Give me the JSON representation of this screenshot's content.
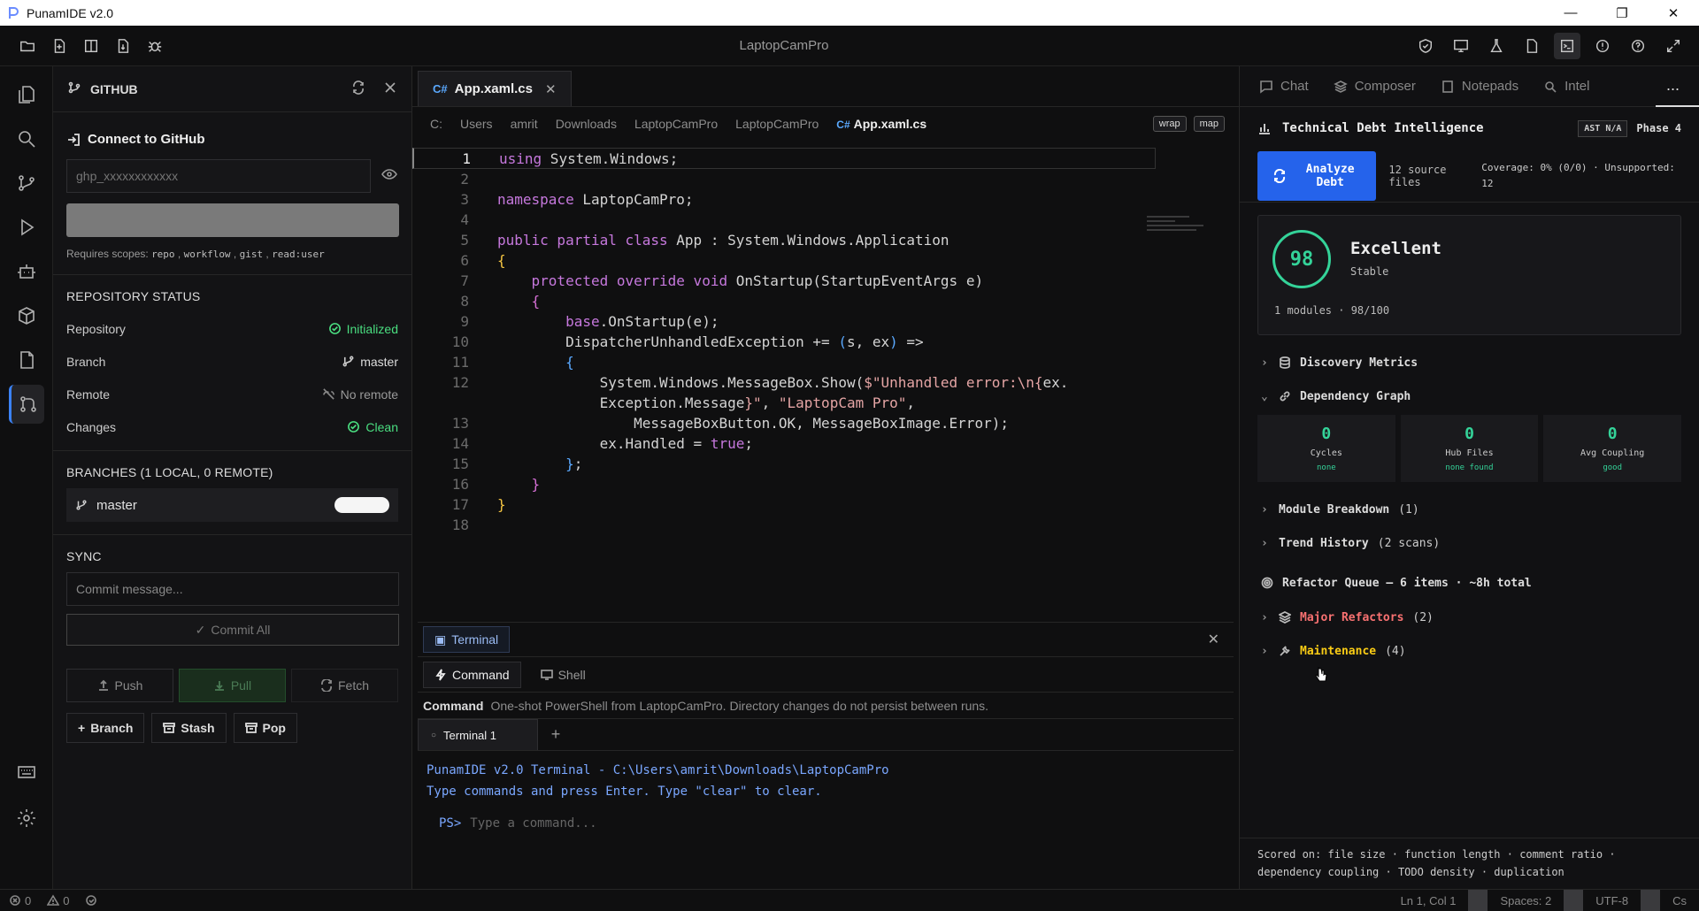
{
  "window": {
    "title": "PunamIDE v2.0",
    "project": "LaptopCamPro"
  },
  "sidebar": {
    "header": "GITHUB",
    "connect_title": "Connect to GitHub",
    "token_placeholder": "ghp_xxxxxxxxxxxx",
    "scopes_label": "Requires scopes:",
    "scopes": [
      "repo",
      "workflow",
      "gist",
      "read:user"
    ],
    "repo_status_title": "REPOSITORY STATUS",
    "repo_status": [
      {
        "label": "Repository",
        "value": "Initialized"
      },
      {
        "label": "Branch",
        "value": "master"
      },
      {
        "label": "Remote",
        "value": "No remote"
      },
      {
        "label": "Changes",
        "value": "Clean"
      }
    ],
    "branches_title": "BRANCHES (1 LOCAL, 0 REMOTE)",
    "branch_name": "master",
    "sync_title": "SYNC",
    "commit_placeholder": "Commit message...",
    "commit_all": "Commit All",
    "push": "Push",
    "pull": "Pull",
    "fetch": "Fetch",
    "branch_btn": "Branch",
    "stash_btn": "Stash",
    "pop_btn": "Pop"
  },
  "editor": {
    "tab": "App.xaml.cs",
    "tab_lang": "C#",
    "breadcrumbs": [
      "C:",
      "Users",
      "amrit",
      "Downloads",
      "LaptopCamPro",
      "LaptopCamPro"
    ],
    "breadcrumb_file": "App.xaml.cs",
    "wrap": "wrap",
    "map": "map",
    "line_numbers": [
      "1",
      "2",
      "3",
      "4",
      "5",
      "6",
      "7",
      "8",
      "9",
      "10",
      "11",
      "12",
      "",
      "13",
      "14",
      "15",
      "16",
      "17",
      "18"
    ]
  },
  "terminal": {
    "panel_tab": "Terminal",
    "mode_command": "Command",
    "mode_shell": "Shell",
    "desc_label": "Command",
    "desc": "One-shot PowerShell from LaptopCamPro. Directory changes do not persist between runs.",
    "tab": "Terminal 1",
    "out1": "PunamIDE v2.0 Terminal - C:\\Users\\amrit\\Downloads\\LaptopCamPro",
    "out2": "Type commands and press Enter. Type \"clear\" to clear.",
    "prompt": "PS>",
    "input_placeholder": "Type a command..."
  },
  "right": {
    "tabs": [
      "Chat",
      "Composer",
      "Notepads",
      "Intel"
    ],
    "more": "...",
    "title": "Technical Debt Intelligence",
    "badge": "AST N/A",
    "phase": "Phase 4",
    "analyze": "Analyze Debt",
    "source_files": "12 source files",
    "coverage": "Coverage: 0% (0/0) · Unsupported: 12",
    "score": "98",
    "grade": "Excellent",
    "trend": "Stable",
    "modules": "1 modules · 98/100",
    "discovery": "Discovery Metrics",
    "dependency": "Dependency Graph",
    "metrics": [
      {
        "value": "0",
        "label": "Cycles",
        "sub": "none"
      },
      {
        "value": "0",
        "label": "Hub Files",
        "sub": "none found"
      },
      {
        "value": "0",
        "label": "Avg Coupling",
        "sub": "good"
      }
    ],
    "module_breakdown": "Module Breakdown",
    "module_count": "(1)",
    "trend_history": "Trend History",
    "trend_count": "(2 scans)",
    "refactor_queue": "Refactor Queue — 6 items · ~8h total",
    "major": "Major Refactors",
    "major_count": "(2)",
    "maintenance": "Maintenance",
    "maintenance_count": "(4)",
    "footnote": "Scored on: file size · function length · comment ratio · dependency coupling · TODO density · duplication",
    "accent": "#2563eb",
    "good_color": "#34d399"
  },
  "status": {
    "errors": "0",
    "warnings": "0",
    "position": "Ln 1, Col 1",
    "spaces": "Spaces: 2",
    "encoding": "UTF-8",
    "lang": "Cs"
  }
}
